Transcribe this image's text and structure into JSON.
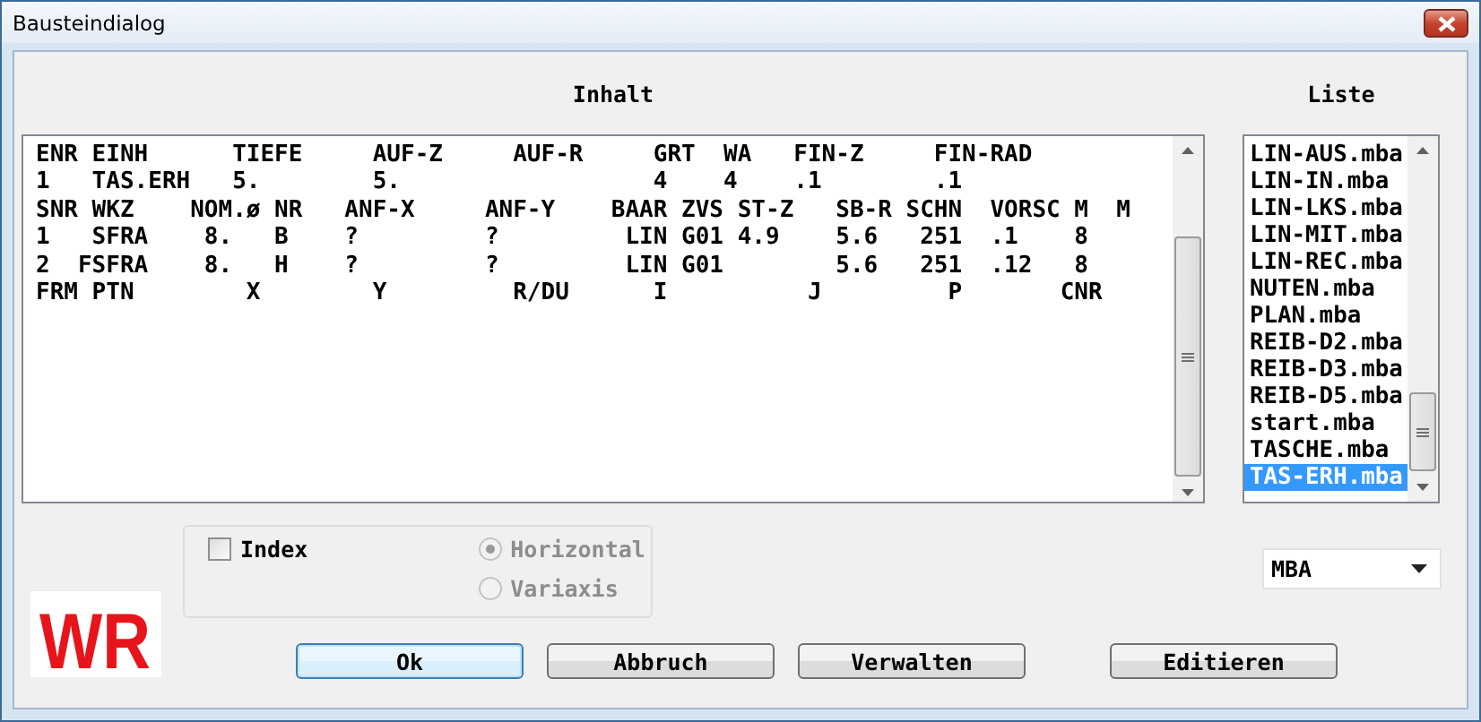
{
  "window": {
    "title": "Bausteindialog"
  },
  "content": {
    "label": "Inhalt",
    "lines": [
      "ENR EINH      TIEFE     AUF-Z     AUF-R     GRT  WA   FIN-Z     FIN-RAD",
      "1   TAS.ERH   5.        5.                  4    4    .1        .1",
      "SNR WKZ    NOM.ø NR   ANF-X     ANF-Y    BAAR ZVS ST-Z   SB-R SCHN  VORSC M  M",
      "1   SFRA    8.   B    ?         ?         LIN G01 4.9    5.6   251  .1    8",
      "2  FSFRA    8.   H    ?         ?         LIN G01        5.6   251  .12   8",
      "FRM PTN        X        Y         R/DU      I          J         P       CNR"
    ]
  },
  "list": {
    "label": "Liste",
    "items": [
      {
        "text": "LIN-AUS.mba",
        "selected": false
      },
      {
        "text": "LIN-IN.mba",
        "selected": false
      },
      {
        "text": "LIN-LKS.mba",
        "selected": false
      },
      {
        "text": "LIN-MIT.mba",
        "selected": false
      },
      {
        "text": "LIN-REC.mba",
        "selected": false
      },
      {
        "text": "NUTEN.mba",
        "selected": false
      },
      {
        "text": "PLAN.mba",
        "selected": false
      },
      {
        "text": "REIB-D2.mba",
        "selected": false
      },
      {
        "text": "REIB-D3.mba",
        "selected": false
      },
      {
        "text": "REIB-D5.mba",
        "selected": false
      },
      {
        "text": "start.mba",
        "selected": false
      },
      {
        "text": "TASCHE.mba",
        "selected": false
      },
      {
        "text": "TAS-ERH.mba",
        "selected": true
      }
    ]
  },
  "options": {
    "index": {
      "label": "Index",
      "checked": false
    },
    "orientation": [
      {
        "label": "Horizontal",
        "selected": true,
        "disabled": true
      },
      {
        "label": "Variaxis",
        "selected": false,
        "disabled": true
      }
    ]
  },
  "logo": {
    "text": "WR"
  },
  "filter": {
    "value": "MBA"
  },
  "buttons": [
    {
      "label": "Ok",
      "focused": true
    },
    {
      "label": "Abbruch",
      "focused": false
    },
    {
      "label": "Verwalten",
      "focused": false
    },
    {
      "label": "Editieren",
      "focused": false
    }
  ]
}
